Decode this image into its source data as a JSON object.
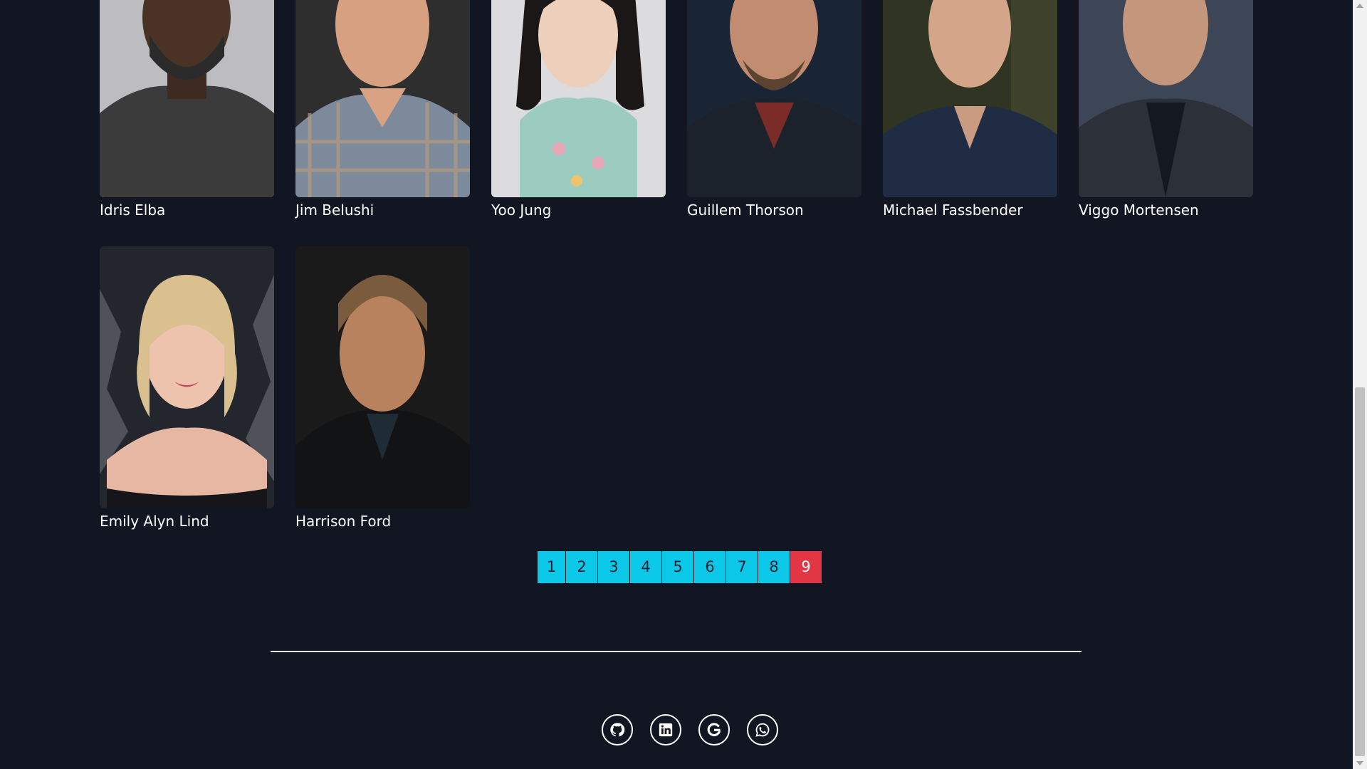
{
  "cast": [
    {
      "name": "Idris Elba"
    },
    {
      "name": "Jim Belushi"
    },
    {
      "name": "Yoo Jung"
    },
    {
      "name": "Guillem Thorson"
    },
    {
      "name": "Michael Fassbender"
    },
    {
      "name": "Viggo Mortensen"
    },
    {
      "name": "Emily Alyn Lind"
    },
    {
      "name": "Harrison Ford"
    }
  ],
  "pagination": {
    "pages": [
      "1",
      "2",
      "3",
      "4",
      "5",
      "6",
      "7",
      "8",
      "9"
    ],
    "current": "9"
  },
  "social": [
    "github-icon",
    "linkedin-icon",
    "google-icon",
    "whatsapp-icon"
  ],
  "colors": {
    "background": "#111622",
    "page_button": "#0bc7e8",
    "active_page": "#e23645"
  }
}
